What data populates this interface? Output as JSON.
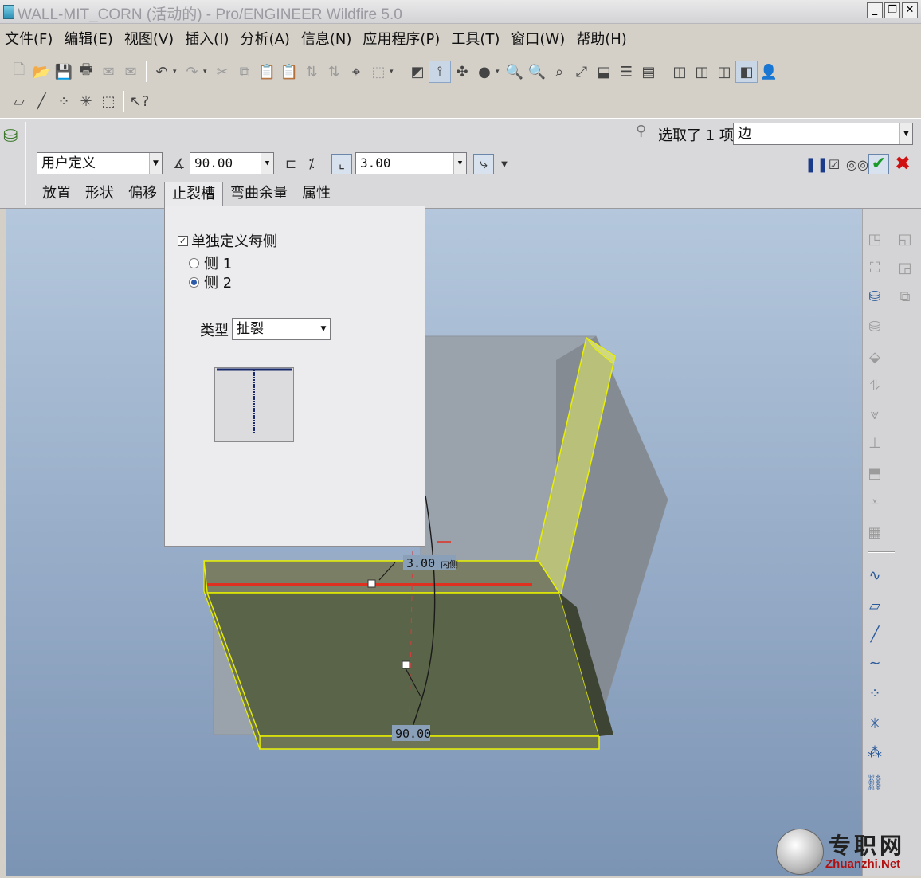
{
  "window": {
    "title": "WALL-MIT_CORN (活动的) - Pro/ENGINEER Wildfire 5.0",
    "minimize": "_",
    "restore": "❐",
    "close": "✕"
  },
  "menu": [
    "文件(F)",
    "编辑(E)",
    "视图(V)",
    "插入(I)",
    "分析(A)",
    "信息(N)",
    "应用程序(P)",
    "工具(T)",
    "窗口(W)",
    "帮助(H)"
  ],
  "dashboard": {
    "shape_type": "用户定义",
    "angle": "90.00",
    "radius": "3.00",
    "collector_label": "选取了 1 项",
    "collector_value": "边",
    "tabs": [
      "放置",
      "形状",
      "偏移",
      "止裂槽",
      "弯曲余量",
      "属性"
    ]
  },
  "relief_panel": {
    "define_each_side": "单独定义每侧",
    "side1": "侧 1",
    "side2": "侧 2",
    "type_label": "类型",
    "type_value": "扯裂"
  },
  "model": {
    "radius_dim": "3.00",
    "radius_side": "内侧",
    "angle_dim": "90.00"
  },
  "colors": {
    "highlight_yellow": "#e8f000",
    "edge_red": "#e03020",
    "model_shade": "#5a6448"
  },
  "watermark": {
    "cn": "专职网",
    "en": "Zhuanzhi.Net"
  }
}
